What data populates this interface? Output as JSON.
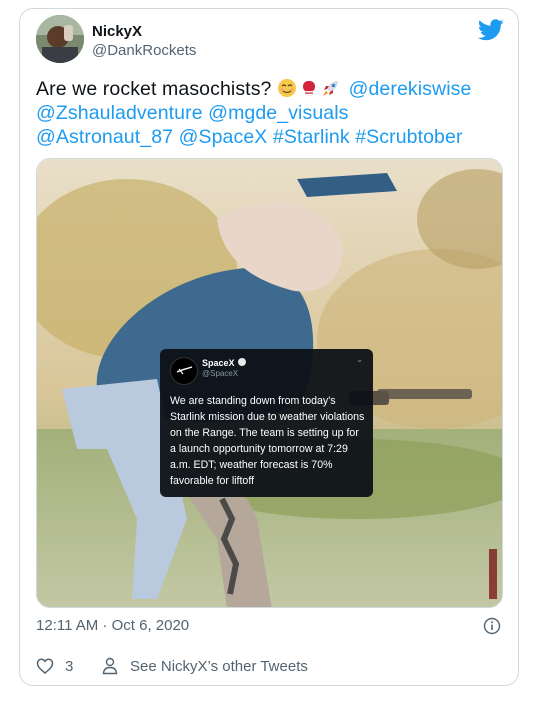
{
  "author": {
    "display_name": "NickyX",
    "handle": "@DankRockets"
  },
  "tweet": {
    "text_lead": "Are we rocket masochists? ",
    "emojis": [
      "relieved-face-emoji",
      "boxing-glove-emoji",
      "rocket-emoji"
    ],
    "mentions_line1": "@derekiswise",
    "mentions_line2": "@Zshauladventure @mgde_visuals",
    "mentions_line3": "@Astronaut_87 @SpaceX #Starlink #Scrubtober"
  },
  "embedded_tweet": {
    "name": "SpaceX",
    "handle": "@SpaceX",
    "text": "We are standing down from today's Starlink mission due to weather violations on the Range. The team is setting up for a launch opportunity tomorrow at 7:29 a.m. EDT; weather forecast is 70% favorable for liftoff"
  },
  "timestamp": "12:11 AM · Oct 6, 2020",
  "actions": {
    "like_count": "3",
    "see_more_label": "See NickyX’s other Tweets"
  },
  "colors": {
    "link": "#1d9bf0",
    "secondary_text": "#536471",
    "border": "#cfd9de",
    "heart": "#536471"
  },
  "icons": {
    "brand": "twitter-bird-icon",
    "info": "info-icon",
    "like": "heart-icon",
    "profile": "person-icon"
  }
}
